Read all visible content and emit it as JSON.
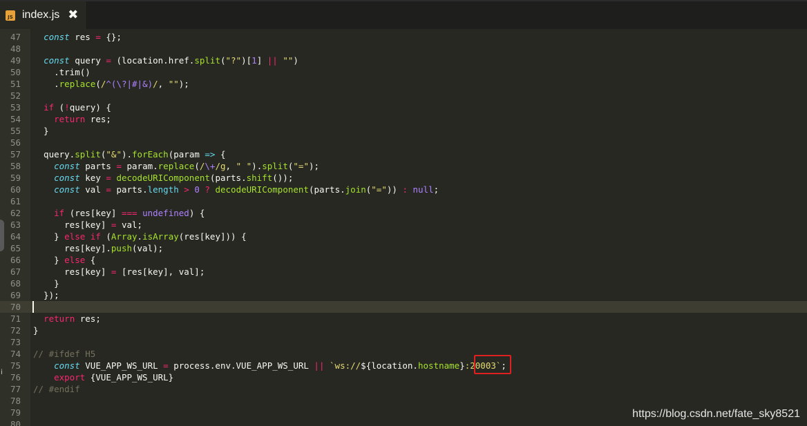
{
  "tab": {
    "icon": "js-file-icon",
    "icon_text": "JS",
    "title": "index.js",
    "close": "✖"
  },
  "watermark": "https://blog.csdn.net/fate_sky8521",
  "lines": [
    {
      "n": "47",
      "html": "  <span class=\"kw\">const</span> res <span class=\"op\">=</span> {};"
    },
    {
      "n": "48",
      "html": ""
    },
    {
      "n": "49",
      "html": "  <span class=\"kw\">const</span> query <span class=\"op\">=</span> (location.href.<span class=\"fn\">split</span>(<span class=\"str\">\"?\"</span>)[<span class=\"num\">1</span>] <span class=\"op\">||</span> <span class=\"str\">\"\"</span>)"
    },
    {
      "n": "50",
      "html": "    .trim()"
    },
    {
      "n": "51",
      "html": "    .<span class=\"fn\">replace</span>(<span class=\"str\">/</span><span class=\"rx\">^(\\?|#|&amp;)</span><span class=\"str\">/</span>, <span class=\"str\">\"\"</span>);"
    },
    {
      "n": "52",
      "html": ""
    },
    {
      "n": "53",
      "html": "  <span class=\"kw2\">if</span> (<span class=\"op\">!</span>query) {"
    },
    {
      "n": "54",
      "html": "    <span class=\"kw2\">return</span> res;"
    },
    {
      "n": "55",
      "html": "  }"
    },
    {
      "n": "56",
      "html": ""
    },
    {
      "n": "57",
      "html": "  query.<span class=\"fn\">split</span>(<span class=\"str\">\"&amp;\"</span>).<span class=\"fn\">forEach</span>(param <span class=\"kw\">=&gt;</span> {"
    },
    {
      "n": "58",
      "html": "    <span class=\"kw\">const</span> parts <span class=\"op\">=</span> param.<span class=\"fn\">replace</span>(<span class=\"str\">/</span><span class=\"rx\">\\+</span><span class=\"str\">/g</span>, <span class=\"str\">\" \"</span>).<span class=\"fn\">split</span>(<span class=\"str\">\"=\"</span>);"
    },
    {
      "n": "59",
      "html": "    <span class=\"kw\">const</span> key <span class=\"op\">=</span> <span class=\"fn\">decodeURIComponent</span>(parts.<span class=\"fn\">shift</span>());"
    },
    {
      "n": "60",
      "html": "    <span class=\"kw\">const</span> val <span class=\"op\">=</span> parts.<span class=\"kw\" style=\"font-style:normal\">length</span> <span class=\"op\">&gt;</span> <span class=\"num\">0</span> <span class=\"op\">?</span> <span class=\"fn\">decodeURIComponent</span>(parts.<span class=\"fn\">join</span>(<span class=\"str\">\"=\"</span>)) <span class=\"op\">:</span> <span class=\"num\">null</span>;"
    },
    {
      "n": "61",
      "html": ""
    },
    {
      "n": "62",
      "html": "    <span class=\"kw2\">if</span> (res[key] <span class=\"op\">===</span> <span class=\"num\">undefined</span>) {"
    },
    {
      "n": "63",
      "html": "      res[key] <span class=\"op\">=</span> val;"
    },
    {
      "n": "64",
      "html": "    } <span class=\"kw2\">else if</span> (<span class=\"kw\" style=\"font-style:normal;color:#a6e22e\">Array</span>.<span class=\"fn\">isArray</span>(res[key])) {"
    },
    {
      "n": "65",
      "html": "      res[key].<span class=\"fn\">push</span>(val);"
    },
    {
      "n": "66",
      "html": "    } <span class=\"kw2\">else</span> {"
    },
    {
      "n": "67",
      "html": "      res[key] <span class=\"op\">=</span> [res[key], val];"
    },
    {
      "n": "68",
      "html": "    }"
    },
    {
      "n": "69",
      "html": "  });"
    },
    {
      "n": "70",
      "html": "",
      "active": true
    },
    {
      "n": "71",
      "html": "  <span class=\"kw2\">return</span> res;"
    },
    {
      "n": "72",
      "html": "}"
    },
    {
      "n": "73",
      "html": ""
    },
    {
      "n": "74",
      "html": "<span class=\"cmt\">// #ifdef H5</span>"
    },
    {
      "n": "75",
      "html": "    <span class=\"kw\">const</span> VUE_APP_WS_URL <span class=\"op\">=</span> process.env.VUE_APP_WS_URL <span class=\"op\">||</span> <span class=\"str\">`ws://</span>${location.<span class=\"fn\">hostname</span>}<span class=\"str\">:20003`</span>;"
    },
    {
      "n": "76",
      "html": "    <span class=\"kw2\">export</span> {VUE_APP_WS_URL}"
    },
    {
      "n": "77",
      "html": "<span class=\"cmt\">// #endif</span>"
    },
    {
      "n": "78",
      "html": ""
    },
    {
      "n": "79",
      "html": ""
    },
    {
      "n": "80",
      "html": ""
    }
  ],
  "gutter_marker": "i"
}
